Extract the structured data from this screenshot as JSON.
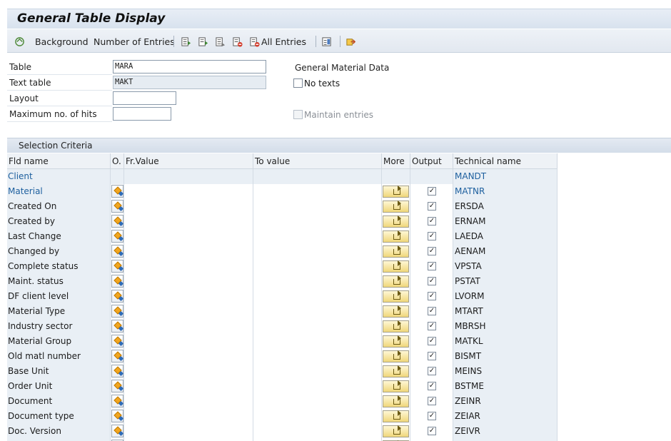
{
  "window": {
    "title": "General Table Display"
  },
  "toolbar": {
    "background_label": "Background",
    "entries_label": "Number of Entries",
    "all_entries_label": "All Entries"
  },
  "form": {
    "table_label": "Table",
    "table_value": "MARA",
    "text_table_label": "Text table",
    "text_table_value": "MAKT",
    "layout_label": "Layout",
    "layout_value": "",
    "max_hits_label": "Maximum no. of hits",
    "max_hits_value": "",
    "description": "General Material Data",
    "no_texts_label": "No texts",
    "maintain_label": "Maintain entries"
  },
  "selection": {
    "title": "Selection Criteria",
    "headers": {
      "fld_name": "Fld name",
      "option": "O.",
      "from": "Fr.Value",
      "to": "To value",
      "more": "More",
      "output": "Output",
      "tech": "Technical name"
    },
    "rows": [
      {
        "name": "Client",
        "tech": "MANDT",
        "blue": true,
        "editable": false
      },
      {
        "name": "Material",
        "tech": "MATNR",
        "blue": true,
        "editable": true,
        "output": "✓"
      },
      {
        "name": "Created On",
        "tech": "ERSDA",
        "editable": true,
        "output": "✓"
      },
      {
        "name": "Created by",
        "tech": "ERNAM",
        "editable": true,
        "output": "✓"
      },
      {
        "name": "Last Change",
        "tech": "LAEDA",
        "editable": true,
        "output": "✓"
      },
      {
        "name": "Changed by",
        "tech": "AENAM",
        "editable": true,
        "output": "✓"
      },
      {
        "name": "Complete status",
        "tech": "VPSTA",
        "editable": true,
        "output": "✓"
      },
      {
        "name": "Maint. status",
        "tech": "PSTAT",
        "editable": true,
        "output": "✓"
      },
      {
        "name": "DF client level",
        "tech": "LVORM",
        "editable": true,
        "output": "✓"
      },
      {
        "name": "Material Type",
        "tech": "MTART",
        "editable": true,
        "output": "✓"
      },
      {
        "name": "Industry sector",
        "tech": "MBRSH",
        "editable": true,
        "output": "✓"
      },
      {
        "name": "Material Group",
        "tech": "MATKL",
        "editable": true,
        "output": "✓"
      },
      {
        "name": "Old matl number",
        "tech": "BISMT",
        "editable": true,
        "output": "✓"
      },
      {
        "name": "Base Unit",
        "tech": "MEINS",
        "editable": true,
        "output": "✓"
      },
      {
        "name": "Order Unit",
        "tech": "BSTME",
        "editable": true,
        "output": "✓"
      },
      {
        "name": "Document",
        "tech": "ZEINR",
        "editable": true,
        "output": "✓"
      },
      {
        "name": "Document type",
        "tech": "ZEIAR",
        "editable": true,
        "output": "✓"
      },
      {
        "name": "Doc. Version",
        "tech": "ZEIVR",
        "editable": true,
        "output": "✓"
      },
      {
        "name": "",
        "tech": "",
        "editable": true,
        "output": ""
      }
    ]
  },
  "colors": {
    "accent_blue": "#1d5f9e",
    "row_shade": "#e9eff5"
  }
}
